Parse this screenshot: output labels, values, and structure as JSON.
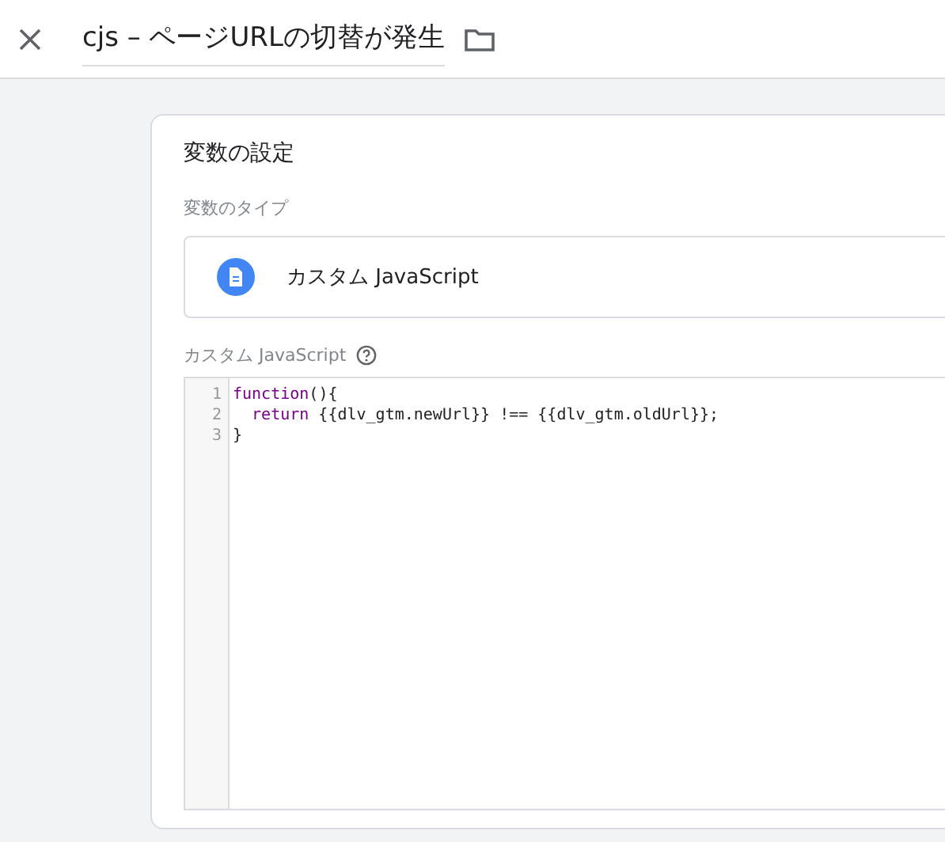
{
  "header": {
    "title": "cjs – ページURLの切替が発生"
  },
  "card": {
    "title": "変数の設定",
    "type_label": "変数のタイプ",
    "type_value": "カスタム JavaScript",
    "editor_label": "カスタム JavaScript",
    "code_lines": [
      {
        "number": "1",
        "tokens": [
          {
            "kind": "keyword",
            "text": "function"
          },
          {
            "kind": "plain",
            "text": "(){"
          }
        ]
      },
      {
        "number": "2",
        "tokens": [
          {
            "kind": "indent"
          },
          {
            "kind": "keyword",
            "text": "return"
          },
          {
            "kind": "plain",
            "text": " {{dlv_gtm.newUrl}} !== {{dlv_gtm.oldUrl}};"
          }
        ]
      },
      {
        "number": "3",
        "tokens": [
          {
            "kind": "plain",
            "text": "}"
          }
        ]
      }
    ]
  }
}
